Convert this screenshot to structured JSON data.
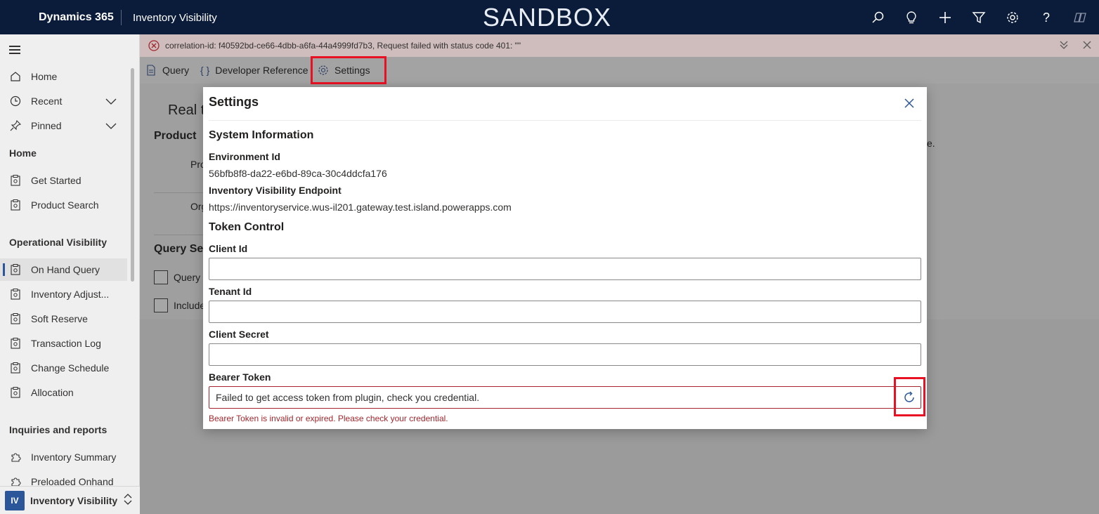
{
  "topbar": {
    "app_name": "Dynamics 365",
    "module": "Inventory Visibility",
    "environment_banner": "SANDBOX",
    "icons": [
      "search-icon",
      "lightbulb-icon",
      "plus-icon",
      "filter-icon",
      "gear-icon",
      "help-icon",
      "copilot-icon"
    ]
  },
  "sidebar": {
    "items_top": [
      {
        "label": "Home",
        "icon": "home-icon"
      },
      {
        "label": "Recent",
        "icon": "clock-icon"
      },
      {
        "label": "Pinned",
        "icon": "pin-icon"
      }
    ],
    "section_home": "Home",
    "home_items": [
      {
        "label": "Get Started"
      },
      {
        "label": "Product Search"
      }
    ],
    "section_operational": "Operational Visibility",
    "operational_items": [
      {
        "label": "On Hand Query"
      },
      {
        "label": "Inventory Adjust..."
      },
      {
        "label": "Soft Reserve"
      },
      {
        "label": "Transaction Log"
      },
      {
        "label": "Change Schedule"
      },
      {
        "label": "Allocation"
      }
    ],
    "section_inquiries": "Inquiries and reports",
    "inquiry_items": [
      {
        "label": "Inventory Summary"
      },
      {
        "label": "Preloaded Onhand"
      }
    ],
    "area": {
      "badge": "IV",
      "name": "Inventory Visibility"
    }
  },
  "errorbar": {
    "message": "correlation-id: f40592bd-ce66-4dbb-a6fa-44a4999fd7b3, Request failed with status code 401: \"\""
  },
  "commandbar": {
    "query": "Query",
    "developer_reference": "Developer Reference",
    "settings": "Settings"
  },
  "background_page": {
    "title": "Real t",
    "product": "Product",
    "pro": "Pro",
    "org": "Org",
    "query_set": "Query Set",
    "query_cb": "Query",
    "include_cb": "Include",
    "trailing": "e."
  },
  "dialog": {
    "title": "Settings",
    "system_information": "System Information",
    "environment_id_label": "Environment Id",
    "environment_id": "56bfb8f8-da22-e6bd-89ca-30c4ddcfa176",
    "endpoint_label": "Inventory Visibility Endpoint",
    "endpoint": "https://inventoryservice.wus-il201.gateway.test.island.powerapps.com",
    "token_control": "Token Control",
    "client_id_label": "Client Id",
    "client_id_value": "",
    "tenant_id_label": "Tenant Id",
    "tenant_id_value": "",
    "client_secret_label": "Client Secret",
    "client_secret_value": "",
    "bearer_token_label": "Bearer Token",
    "bearer_token_value": "Failed to get access token from plugin, check you credential.",
    "bearer_token_error": "Bearer Token is invalid or expired. Please check your credential."
  },
  "colors": {
    "topbar_bg": "#0b1b3a",
    "accent": "#2b579a",
    "error": "#a4262c",
    "highlight": "#e81123"
  }
}
